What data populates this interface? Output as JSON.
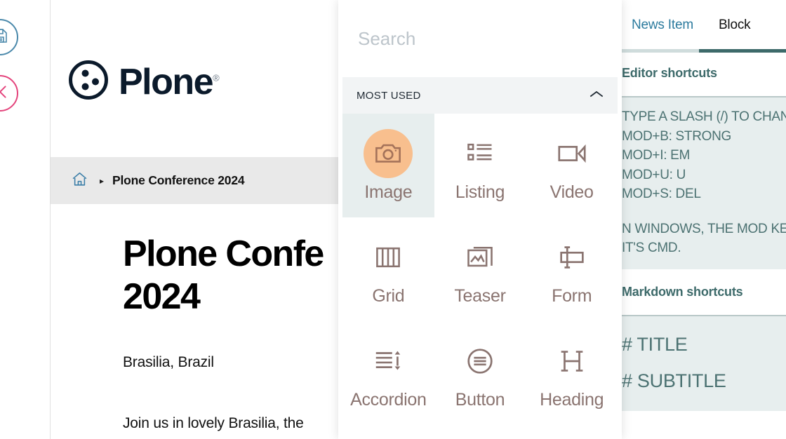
{
  "toolbar": {
    "save": {
      "name": "save-button",
      "icon": "floppy-disk-icon",
      "color": "#4b89ab"
    },
    "cancel": {
      "name": "cancel-button",
      "icon": "close-x-icon",
      "color": "#e4447c"
    }
  },
  "document": {
    "logo_text": "Plone",
    "logo_registered": "®",
    "breadcrumb": {
      "home_icon": "home-icon",
      "separator": "▸",
      "current": "Plone Conference 2024"
    },
    "title": "Plone Confe\n2024",
    "subtitle": "Brasilia, Brazil",
    "body": "Join us in lovely Brasilia, the"
  },
  "chooser": {
    "search_placeholder": "Search",
    "search_value": "",
    "group_label": "MOST USED",
    "collapse_icon": "chevron-up-icon",
    "blocks": [
      {
        "label": "Image",
        "icon": "camera-icon",
        "selected": true
      },
      {
        "label": "Listing",
        "icon": "list-icon",
        "selected": false
      },
      {
        "label": "Video",
        "icon": "video-icon",
        "selected": false
      },
      {
        "label": "Grid",
        "icon": "grid-icon",
        "selected": false
      },
      {
        "label": "Teaser",
        "icon": "teaser-icon",
        "selected": false
      },
      {
        "label": "Form",
        "icon": "form-icon",
        "selected": false
      },
      {
        "label": "Accordion",
        "icon": "accordion-icon",
        "selected": false
      },
      {
        "label": "Button",
        "icon": "button-icon",
        "selected": false
      },
      {
        "label": "Heading",
        "icon": "heading-icon",
        "selected": false
      }
    ],
    "accent_selected_bg": "#e7eeee",
    "icon_color": "#8a7470",
    "image_circle_color": "#f8bf8e"
  },
  "sidebar": {
    "tabs": [
      {
        "label": "News Item",
        "active": false
      },
      {
        "label": "Block",
        "active": true
      }
    ],
    "editor_shortcuts": {
      "heading": "Editor shortcuts",
      "lines": [
        "TYPE A SLASH (/) TO CHANGE",
        "MOD+B: STRONG",
        "MOD+I: EM",
        "MOD+U: U",
        "MOD+S: DEL"
      ],
      "note": [
        "N WINDOWS, THE MOD KE",
        "IT'S CMD."
      ]
    },
    "markdown_shortcuts": {
      "heading": "Markdown shortcuts",
      "lines": [
        "# TITLE",
        "# SUBTITLE"
      ]
    },
    "accent": "#3d6a6a",
    "tab_inactive_color": "#2c7b9e",
    "panel_bg": "#e7eeee"
  }
}
